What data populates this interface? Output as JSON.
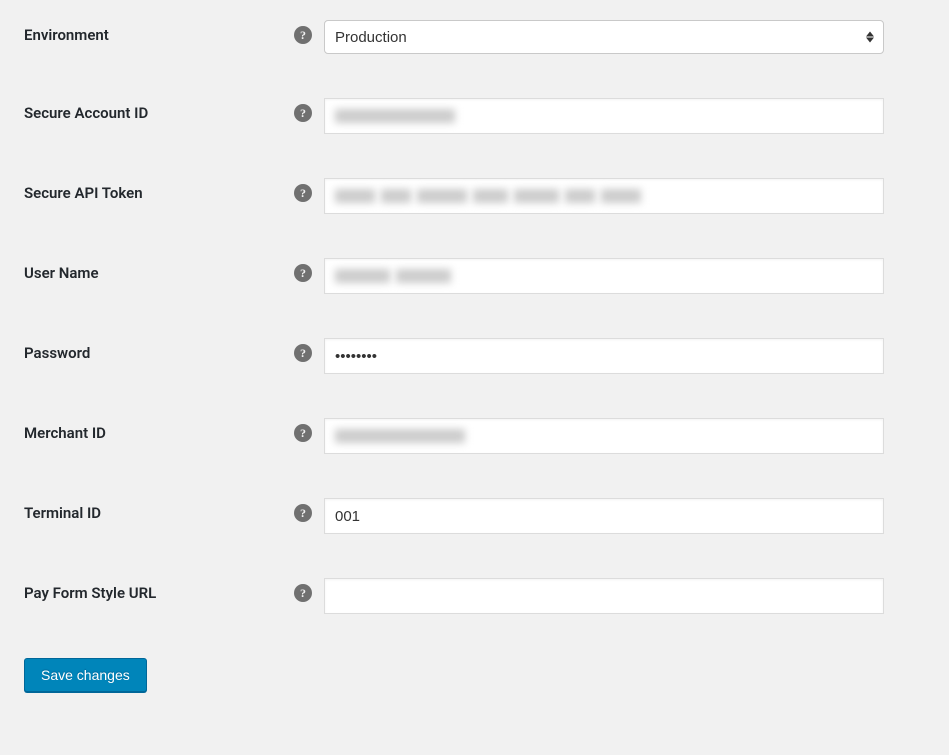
{
  "fields": {
    "environment": {
      "label": "Environment",
      "value": "Production"
    },
    "secure_account_id": {
      "label": "Secure Account ID",
      "value": "",
      "redacted": true
    },
    "secure_api_token": {
      "label": "Secure API Token",
      "value": "",
      "redacted": true
    },
    "user_name": {
      "label": "User Name",
      "value": "",
      "redacted": true
    },
    "password": {
      "label": "Password",
      "value": "••••••••"
    },
    "merchant_id": {
      "label": "Merchant ID",
      "value": "",
      "redacted": true
    },
    "terminal_id": {
      "label": "Terminal ID",
      "value": "001"
    },
    "pay_form_style_url": {
      "label": "Pay Form Style URL",
      "value": ""
    }
  },
  "actions": {
    "save_label": "Save changes"
  },
  "help_glyph": "?"
}
